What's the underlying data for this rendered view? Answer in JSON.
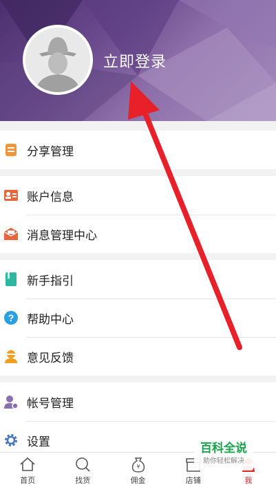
{
  "header": {
    "login_label": "立即登录",
    "colors": {
      "gradient_start": "#4a2f6e",
      "gradient_end": "#a48cbd"
    }
  },
  "menu": {
    "groups": [
      [
        {
          "label": "分享管理",
          "icon": "share-manage-icon",
          "color": "#f0953a"
        }
      ],
      [
        {
          "label": "账户信息",
          "icon": "account-info-icon",
          "color": "#e8663d"
        },
        {
          "label": "消息管理中心",
          "icon": "message-center-icon",
          "color": "#e8663d"
        }
      ],
      [
        {
          "label": "新手指引",
          "icon": "guide-book-icon",
          "color": "#2fb6a0"
        },
        {
          "label": "帮助中心",
          "icon": "help-icon",
          "color": "#2aa0e0"
        },
        {
          "label": "意见反馈",
          "icon": "feedback-icon",
          "color": "#f0a020"
        }
      ],
      [
        {
          "label": "帐号管理",
          "icon": "account-manage-icon",
          "color": "#8a6fb0"
        },
        {
          "label": "设置",
          "icon": "settings-gear-icon",
          "color": "#4a78c0"
        }
      ]
    ]
  },
  "tabbar": {
    "tabs": [
      {
        "label": "首页",
        "icon": "home-icon"
      },
      {
        "label": "找货",
        "icon": "search-icon"
      },
      {
        "label": "佣金",
        "icon": "money-bag-icon"
      },
      {
        "label": "店铺",
        "icon": "shop-icon"
      },
      {
        "label": "我",
        "icon": "me-icon",
        "active": true
      }
    ],
    "active_color": "#e02a2a"
  },
  "watermark": {
    "title": "百科全说",
    "subtitle": "助你轻松解决"
  },
  "annotation_arrow_color": "#e8202a"
}
